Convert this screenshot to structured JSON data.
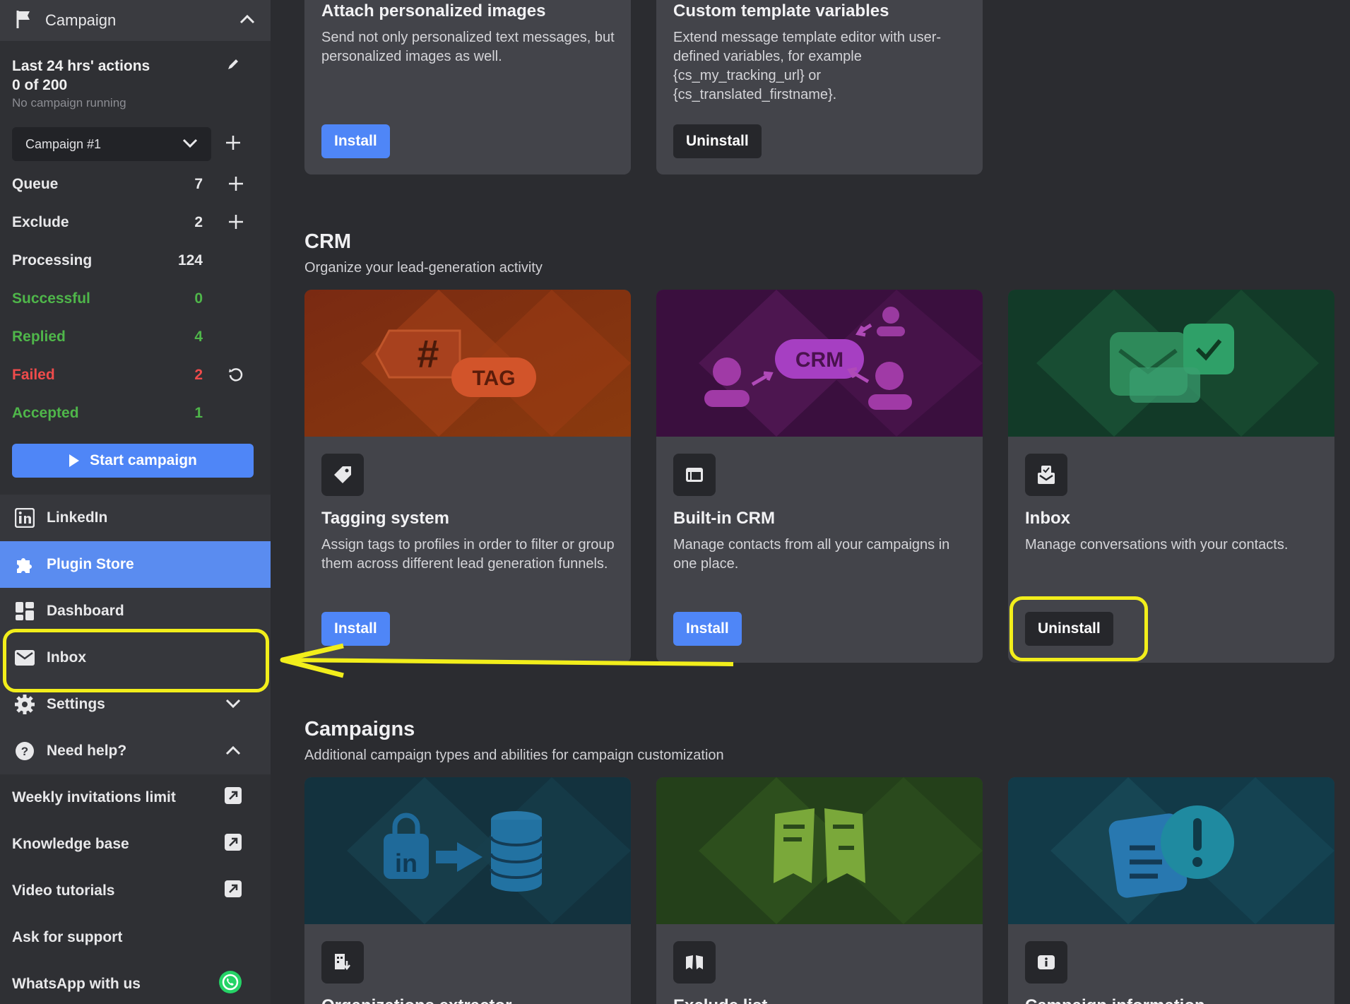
{
  "sidebar": {
    "header_label": "Campaign",
    "stats": {
      "title": "Last 24 hrs' actions",
      "count": "0 of 200",
      "status": "No campaign running"
    },
    "campaign_select": "Campaign #1",
    "rows": [
      {
        "label": "Queue",
        "value": "7"
      },
      {
        "label": "Exclude",
        "value": "2"
      },
      {
        "label": "Processing",
        "value": "124"
      },
      {
        "label": "Successful",
        "value": "0"
      },
      {
        "label": "Replied",
        "value": "4"
      },
      {
        "label": "Failed",
        "value": "2"
      },
      {
        "label": "Accepted",
        "value": "1"
      }
    ],
    "start_button": "Start campaign",
    "nav": [
      {
        "label": "LinkedIn"
      },
      {
        "label": "Plugin Store"
      },
      {
        "label": "Dashboard"
      },
      {
        "label": "Inbox"
      },
      {
        "label": "Settings"
      },
      {
        "label": "Need help?"
      }
    ],
    "help_links": [
      {
        "label": "Weekly invitations limit"
      },
      {
        "label": "Knowledge base"
      },
      {
        "label": "Video tutorials"
      },
      {
        "label": "Ask for support"
      },
      {
        "label": "WhatsApp with us"
      }
    ]
  },
  "top_cards": [
    {
      "title": "Attach personalized images",
      "desc": "Send not only personalized text messages, but personalized images as well.",
      "button": "Install"
    },
    {
      "title": "Custom template variables",
      "desc1": "Extend message template editor with user-defined variables, for example",
      "desc2": "{cs_my_tracking_url} or",
      "desc3": "{cs_translated_firstname}.",
      "button": "Uninstall"
    }
  ],
  "crm": {
    "title": "CRM",
    "subtitle": "Organize your lead-generation activity",
    "cards": [
      {
        "banner_text": "TAG",
        "title": "Tagging system",
        "desc": "Assign tags to profiles in order to filter or group them across different lead generation funnels.",
        "button": "Install"
      },
      {
        "banner_text": "CRM",
        "title": "Built-in CRM",
        "desc": "Manage contacts from all your campaigns in one place.",
        "button": "Install"
      },
      {
        "title": "Inbox",
        "desc": "Manage conversations with your contacts.",
        "button": "Uninstall"
      }
    ]
  },
  "campaigns": {
    "title": "Campaigns",
    "subtitle": "Additional campaign types and abilities for campaign customization",
    "cards": [
      {
        "banner_text": "in",
        "title": "Organizations extractor"
      },
      {
        "title": "Exclude list"
      },
      {
        "title": "Campaign information"
      }
    ]
  },
  "colors": {
    "accent": "#4f86f7",
    "highlight": "#f2ee1b",
    "success": "#4fb64a",
    "failed": "#ef4b4b"
  }
}
